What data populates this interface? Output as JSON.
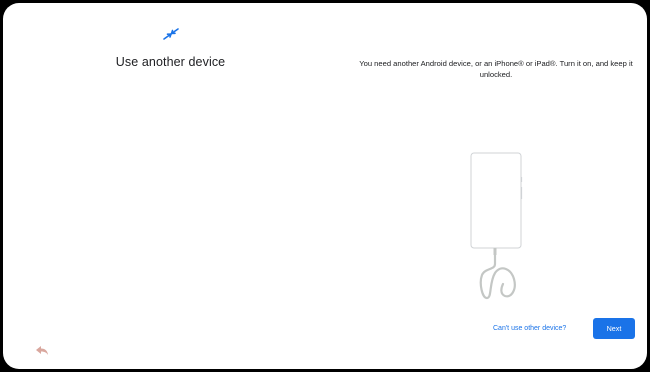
{
  "icons": {
    "header": "transfer-arrows-icon",
    "back": "back-arrow-icon",
    "illustration": "phone-with-cable-icon"
  },
  "colors": {
    "accent": "#1a73e8",
    "back_icon": "#d9a79e",
    "illustration_stroke": "#c4c7c5"
  },
  "left": {
    "title": "Use another device"
  },
  "right": {
    "description": "You need another Android device, or an iPhone® or iPad®. Turn it on, and keep it unlocked."
  },
  "actions": {
    "cant_use_label": "Can't use other device?",
    "next_label": "Next"
  }
}
